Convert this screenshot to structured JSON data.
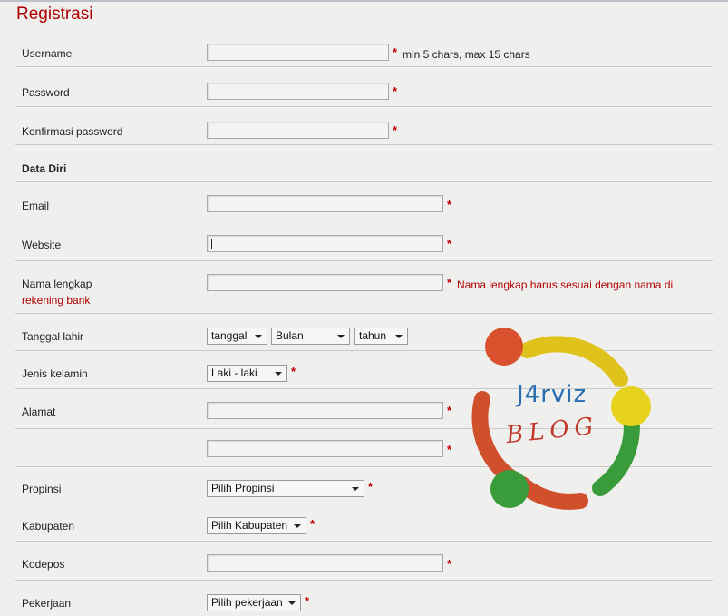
{
  "title": "Registrasi",
  "fields": {
    "username": {
      "label": "Username",
      "hint": "min 5 chars, max 15 chars",
      "value": ""
    },
    "password": {
      "label": "Password",
      "value": ""
    },
    "confirm_password": {
      "label": "Konfirmasi password",
      "value": ""
    },
    "section_personal": {
      "label": "Data Diri"
    },
    "email": {
      "label": "Email",
      "value": ""
    },
    "website": {
      "label": "Website",
      "value": ""
    },
    "full_name": {
      "label": "Nama lengkap",
      "label_line2": "rekening bank",
      "hint": "Nama lengkap harus sesuai dengan nama di",
      "value": ""
    },
    "birth_date": {
      "label": "Tanggal lahir",
      "day": "tanggal",
      "month": "Bulan",
      "year": "tahun"
    },
    "gender": {
      "label": "Jenis kelamin",
      "selected": "Laki - laki"
    },
    "address": {
      "label": "Alamat",
      "line1": "",
      "line2": ""
    },
    "province": {
      "label": "Propinsi",
      "selected": "Pilih Propinsi"
    },
    "regency": {
      "label": "Kabupaten",
      "selected": "Pilih Kabupaten"
    },
    "postal_code": {
      "label": "Kodepos",
      "value": ""
    },
    "occupation": {
      "label": "Pekerjaan",
      "selected": "Pilih pekerjaan"
    }
  },
  "required_marker": "*",
  "logo": {
    "line1": "J4rviz",
    "line2": "BLOG"
  },
  "colors": {
    "accent": "#b10000",
    "required": "#c00000",
    "background": "#efefee"
  }
}
